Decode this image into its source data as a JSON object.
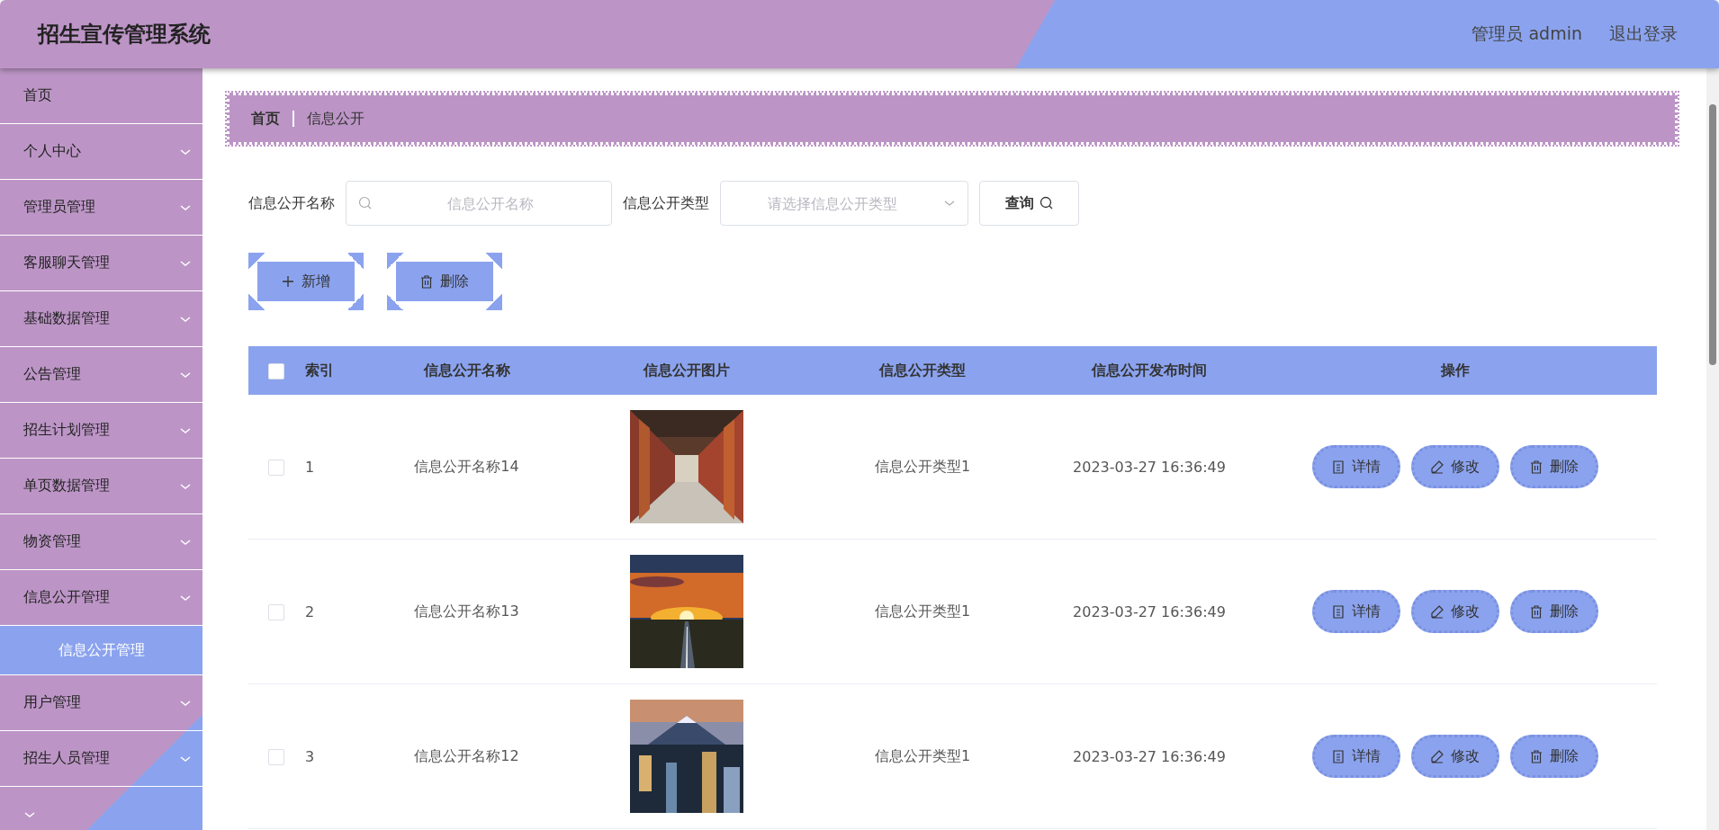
{
  "header": {
    "title": "招生宣传管理系统",
    "user": "管理员 admin",
    "logout": "退出登录"
  },
  "sidebar": {
    "items": [
      {
        "kind": "link",
        "label": "首页",
        "selected": false
      },
      {
        "kind": "menu",
        "label": "个人中心",
        "selected": false
      },
      {
        "kind": "menu",
        "label": "管理员管理",
        "selected": false
      },
      {
        "kind": "menu",
        "label": "客服聊天管理",
        "selected": false
      },
      {
        "kind": "menu",
        "label": "基础数据管理",
        "selected": false
      },
      {
        "kind": "menu",
        "label": "公告管理",
        "selected": false
      },
      {
        "kind": "menu",
        "label": "招生计划管理",
        "selected": false
      },
      {
        "kind": "menu",
        "label": "单页数据管理",
        "selected": false
      },
      {
        "kind": "menu",
        "label": "物资管理",
        "selected": false
      },
      {
        "kind": "menu",
        "label": "信息公开管理",
        "selected": false,
        "children": [
          {
            "label": "信息公开管理",
            "selected": true
          }
        ]
      },
      {
        "kind": "menu",
        "label": "用户管理",
        "selected": false
      },
      {
        "kind": "menu",
        "label": "招生人员管理",
        "selected": false
      },
      {
        "kind": "menu",
        "selected": false
      }
    ]
  },
  "breadcrumb": [
    "首页",
    "信息公开"
  ],
  "search": {
    "name_label": "信息公开名称",
    "name_placeholder": "信息公开名称",
    "type_label": "信息公开类型",
    "type_placeholder": "请选择信息公开类型",
    "query_button": "查询"
  },
  "actions": [
    "新增",
    "删除"
  ],
  "table": {
    "columns": [
      "索引",
      "信息公开名称",
      "信息公开图片",
      "信息公开类型",
      "信息公开发布时间",
      "操作"
    ],
    "header_checked": false,
    "rows": [
      {
        "checked": false,
        "index": "1",
        "name": "信息公开名称14",
        "type": "信息公开类型1",
        "time": "2023-03-27 16:36:49",
        "ops": [
          "详情",
          "修改",
          "删除"
        ]
      },
      {
        "checked": false,
        "index": "2",
        "name": "信息公开名称13",
        "type": "信息公开类型1",
        "time": "2023-03-27 16:36:49",
        "ops": [
          "详情",
          "修改",
          "删除"
        ]
      },
      {
        "checked": false,
        "index": "3",
        "name": "信息公开名称12",
        "type": "信息公开类型1",
        "time": "2023-03-27 16:36:49",
        "ops": [
          "详情",
          "修改",
          "删除"
        ]
      }
    ]
  }
}
